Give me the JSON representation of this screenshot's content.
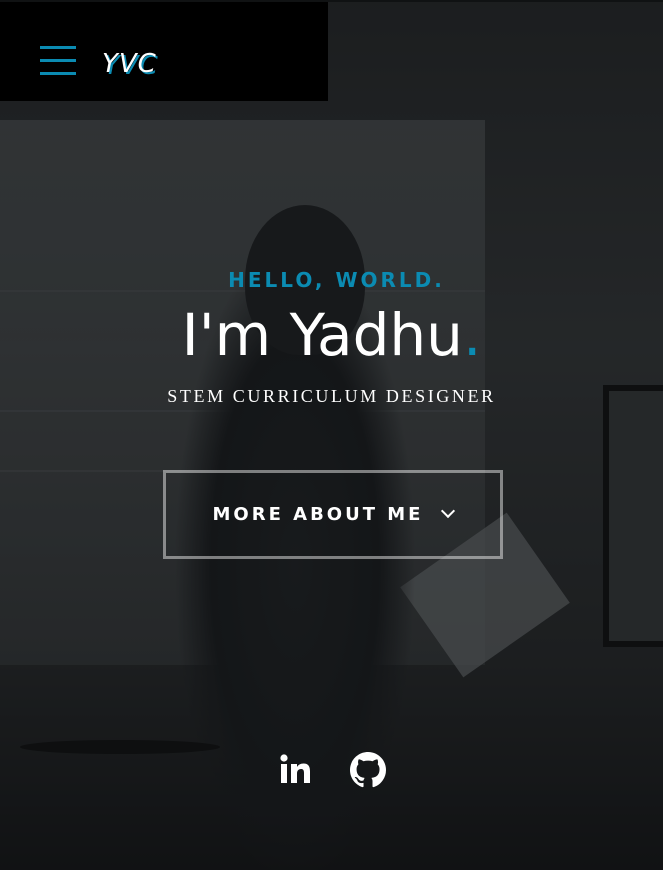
{
  "header": {
    "logo": "YVC",
    "menu_icon": "hamburger-menu-icon"
  },
  "intro": {
    "greeting": "HELLO, WORLD.",
    "name": "I'm Yadhu",
    "name_dot": ".",
    "role": "STEM CURRICULUM DESIGNER",
    "cta_label": "MORE ABOUT ME",
    "cta_icon": "chevron-down-icon"
  },
  "social": [
    {
      "icon": "linkedin-icon"
    },
    {
      "icon": "github-icon"
    }
  ],
  "colors": {
    "accent": "#0b8bb2",
    "header_bg": "#000000",
    "text": "#ffffff"
  }
}
